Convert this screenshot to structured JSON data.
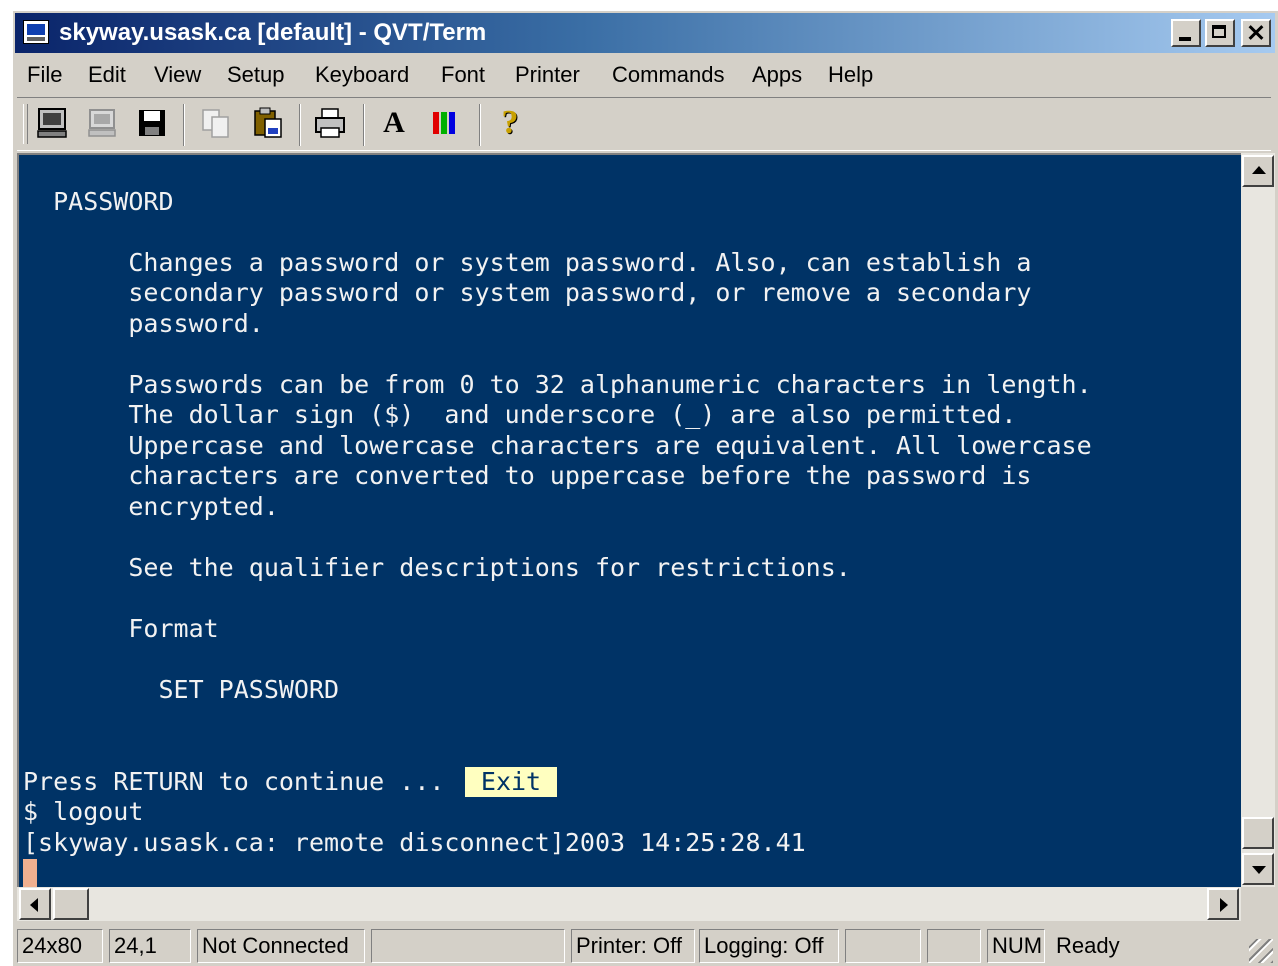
{
  "window": {
    "title": "skyway.usask.ca [default] - QVT/Term"
  },
  "menu": [
    "File",
    "Edit",
    "View",
    "Setup",
    "Keyboard",
    "Font",
    "Printer",
    "Commands",
    "Apps",
    "Help"
  ],
  "toolbar": {
    "icons": [
      "terminal-icon",
      "disconnect-icon",
      "save-icon",
      "copy-icon",
      "paste-icon",
      "print-icon",
      "font-icon",
      "color-icon",
      "help-icon"
    ],
    "font_glyph": "A",
    "help_glyph": "?"
  },
  "terminal": {
    "lines": [
      "  PASSWORD",
      "",
      "       Changes a password or system password. Also, can establish a",
      "       secondary password or system password, or remove a secondary",
      "       password.",
      "",
      "       Passwords can be from 0 to 32 alphanumeric characters in length.",
      "       The dollar sign ($)  and underscore (_) are also permitted.",
      "       Uppercase and lowercase characters are equivalent. All lowercase",
      "       characters are converted to uppercase before the password is",
      "       encrypted.",
      "",
      "       See the qualifier descriptions for restrictions.",
      "",
      "       Format",
      "",
      "         SET PASSWORD",
      "",
      "",
      "Press RETURN to continue ...",
      "$ logout",
      "[skyway.usask.ca: remote disconnect]2003 14:25:28.41"
    ],
    "exit_button": "Exit",
    "background": "#003366",
    "foreground": "#f2f2f2",
    "highlight": "#ffffc0",
    "cursor_color": "#f0b090"
  },
  "status": {
    "size": "24x80",
    "position": "24,1",
    "connection": "Not Connected",
    "blank1": "",
    "printer": "Printer: Off",
    "logging": "Logging: Off",
    "blank2": "",
    "blank3": "",
    "num": "NUM",
    "ready": "Ready"
  }
}
